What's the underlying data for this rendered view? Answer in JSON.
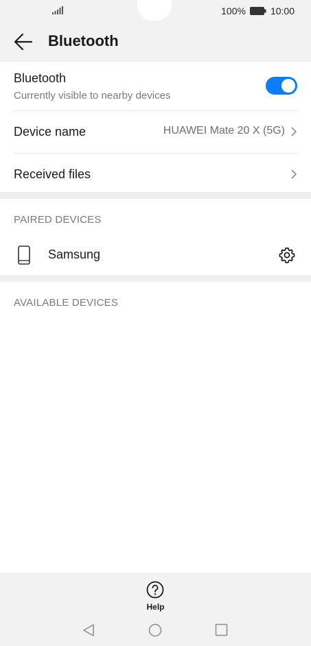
{
  "status_bar": {
    "battery_percent": "100%",
    "time": "10:00",
    "icons": [
      "signal-icon",
      "battery-icon"
    ]
  },
  "header": {
    "title": "Bluetooth",
    "back_icon": "back-arrow-icon"
  },
  "settings": {
    "bluetooth": {
      "title": "Bluetooth",
      "subtitle": "Currently visible to nearby devices",
      "enabled": true
    },
    "device_name": {
      "title": "Device name",
      "value": "HUAWEI Mate 20 X (5G)"
    },
    "received_files": {
      "title": "Received files"
    }
  },
  "paired_devices": {
    "header": "PAIRED DEVICES",
    "items": [
      {
        "name": "Samsung",
        "icon": "phone-icon",
        "action_icon": "gear-icon"
      }
    ]
  },
  "available_devices": {
    "header": "AVAILABLE DEVICES"
  },
  "help": {
    "label": "Help",
    "icon": "help-icon"
  },
  "nav": {
    "icons": [
      "nav-back-icon",
      "nav-home-icon",
      "nav-recent-icon"
    ]
  },
  "colors": {
    "accent": "#0a7ef8",
    "bar_background": "#f2f2f2",
    "band": "#eeeeee"
  }
}
